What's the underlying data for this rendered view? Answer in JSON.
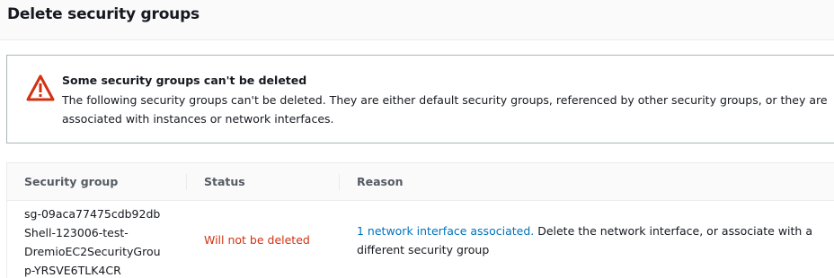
{
  "dialog": {
    "title": "Delete security groups"
  },
  "alert": {
    "icon": "warning-icon",
    "icon_color": "#d13212",
    "heading": "Some security groups can't be deleted",
    "body": "The following security groups can't be deleted. They are either default security groups, referenced by other security groups, or they are associated with instances or network interfaces."
  },
  "table": {
    "columns": [
      "Security group",
      "Status",
      "Reason"
    ],
    "rows": [
      {
        "security_group_lines": [
          "sg-09aca77475cdb92db",
          "Shell-123006-test-",
          "DremioEC2SecurityGrou",
          "p-YRSVE6TLK4CR"
        ],
        "status": "Will not be deleted",
        "reason_link": "1 network interface associated.",
        "reason_text_line1": " Delete the network interface, or associate with a",
        "reason_text_line2": "different security group"
      }
    ]
  },
  "colors": {
    "status_error": "#d13212",
    "link": "#0073bb"
  }
}
